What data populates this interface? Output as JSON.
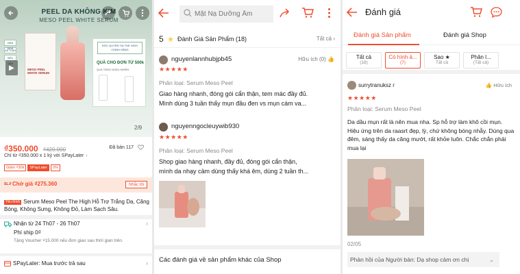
{
  "panel1": {
    "hero": {
      "title": "PEEL DA KHÔNG KIM",
      "subtitle": "MESO PEEL WHITE SERUM",
      "box_text": "MESO PEEL WHITE SERUM",
      "promo_tag": "ĐỘC QUYỀN TẠI THE HIGH CHÍNH HÃNG",
      "promo_gift": "QUÀ CHO ĐƠN TỪ 500k",
      "promo_small": "QUÀ TĂNG NGẪU NHIÊN",
      "checks": [
        "KIỂM ĐỊNH",
        "AN TOÀN",
        "HIỆU QUẢ"
      ],
      "counter": "2/9"
    },
    "price": "₫350.000",
    "old_price": "₫420.000",
    "sold": "Đã bán 117",
    "installment": "Chỉ từ ₫350.000 x 1 kỳ với SPayLater",
    "vouchers": [
      "Giảm ₫30k",
      "SPayLater",
      "0%"
    ],
    "flash": {
      "logo": "SL.F",
      "price": "Chờ giá ₫275.360",
      "remind": "Nhắc tôi"
    },
    "title_badge": "Yêu thích",
    "title": "Serum Meso Peel The High Hỗ Trợ Trắng Da, Căng Bóng, Không Sưng, Không Đỏ, Làm Sạch Sâu.",
    "shipping": {
      "line1": "Nhận từ 24 Th07 - 26 Th07",
      "line2": "Phí ship 0₫",
      "line3": "Tặng Voucher ₫15.000 nếu đơn giao sau thời gian trên."
    },
    "spaylater": "SPayLater: Mua trước trả sau"
  },
  "panel2": {
    "search_placeholder": "Mặt Nạ Dưỡng Ẩm",
    "rating": "5",
    "reviews_label": "Đánh Giá Sản Phẩm (18)",
    "see_all": "Tất cả",
    "reviews": [
      {
        "user": "nguyenlannhubjpb45",
        "useful": "Hữu ích (0)",
        "stars": "★★★★★",
        "variant": "Phân loại: Serum Meso Peel",
        "lines": [
          "Giao hàng nhanh, đóng gói cẩn thận, tem mác đầy đủ.",
          "Mình dùng 3 tuần thấy mụn đầu đen vs mụn cám va..."
        ]
      },
      {
        "user": "nguyenngocleuywib930",
        "useful": "Hữu ích (0)",
        "stars": "★★★★★",
        "variant": "Phân loại: Serum Meso Peel",
        "lines": [
          "Shop giao hàng nhanh, đầy đủ, đóng gói cẩn thận,",
          "mình da nhạy cảm dùng thấy khá êm, dùng 2 tuần th..."
        ]
      }
    ],
    "other_reviews": "Các đánh giá về sản phẩm khác của Shop"
  },
  "panel3": {
    "title": "Đánh giá",
    "tabs": [
      "Đánh giá Sản phẩm",
      "Đánh giá Shop"
    ],
    "filters": [
      {
        "a": "Tất cả",
        "b": "(18)"
      },
      {
        "a": "Có hình ả...",
        "b": "(7)"
      },
      {
        "a": "Sao ★",
        "b": "Tất cả"
      },
      {
        "a": "Phân l...",
        "b": "(Tất cả)"
      }
    ],
    "review": {
      "user": "surrytranuksz r",
      "useful": "Hữu ích",
      "stars": "★★★★★",
      "variant": "Phân loại: Serum Meso Peel",
      "text": "Da dầu mụn rất là nên mua nha. Sp hỗ trợ làm khô cồi mụn. Hiệu ứng trên da raasrt đẹp, lỳ, chứ không bóng nhẫy. Dùng qua đêm, sáng thấy da căng mướt, rất khỏe luôn. Chắc chắn phải mua lại",
      "date": "02/05"
    },
    "reply": "Phản hồi của Người bán: Dạ shop cảm ơn chị"
  },
  "colors": {
    "accent": "#ee4d2d",
    "star": "#ffce3d"
  }
}
